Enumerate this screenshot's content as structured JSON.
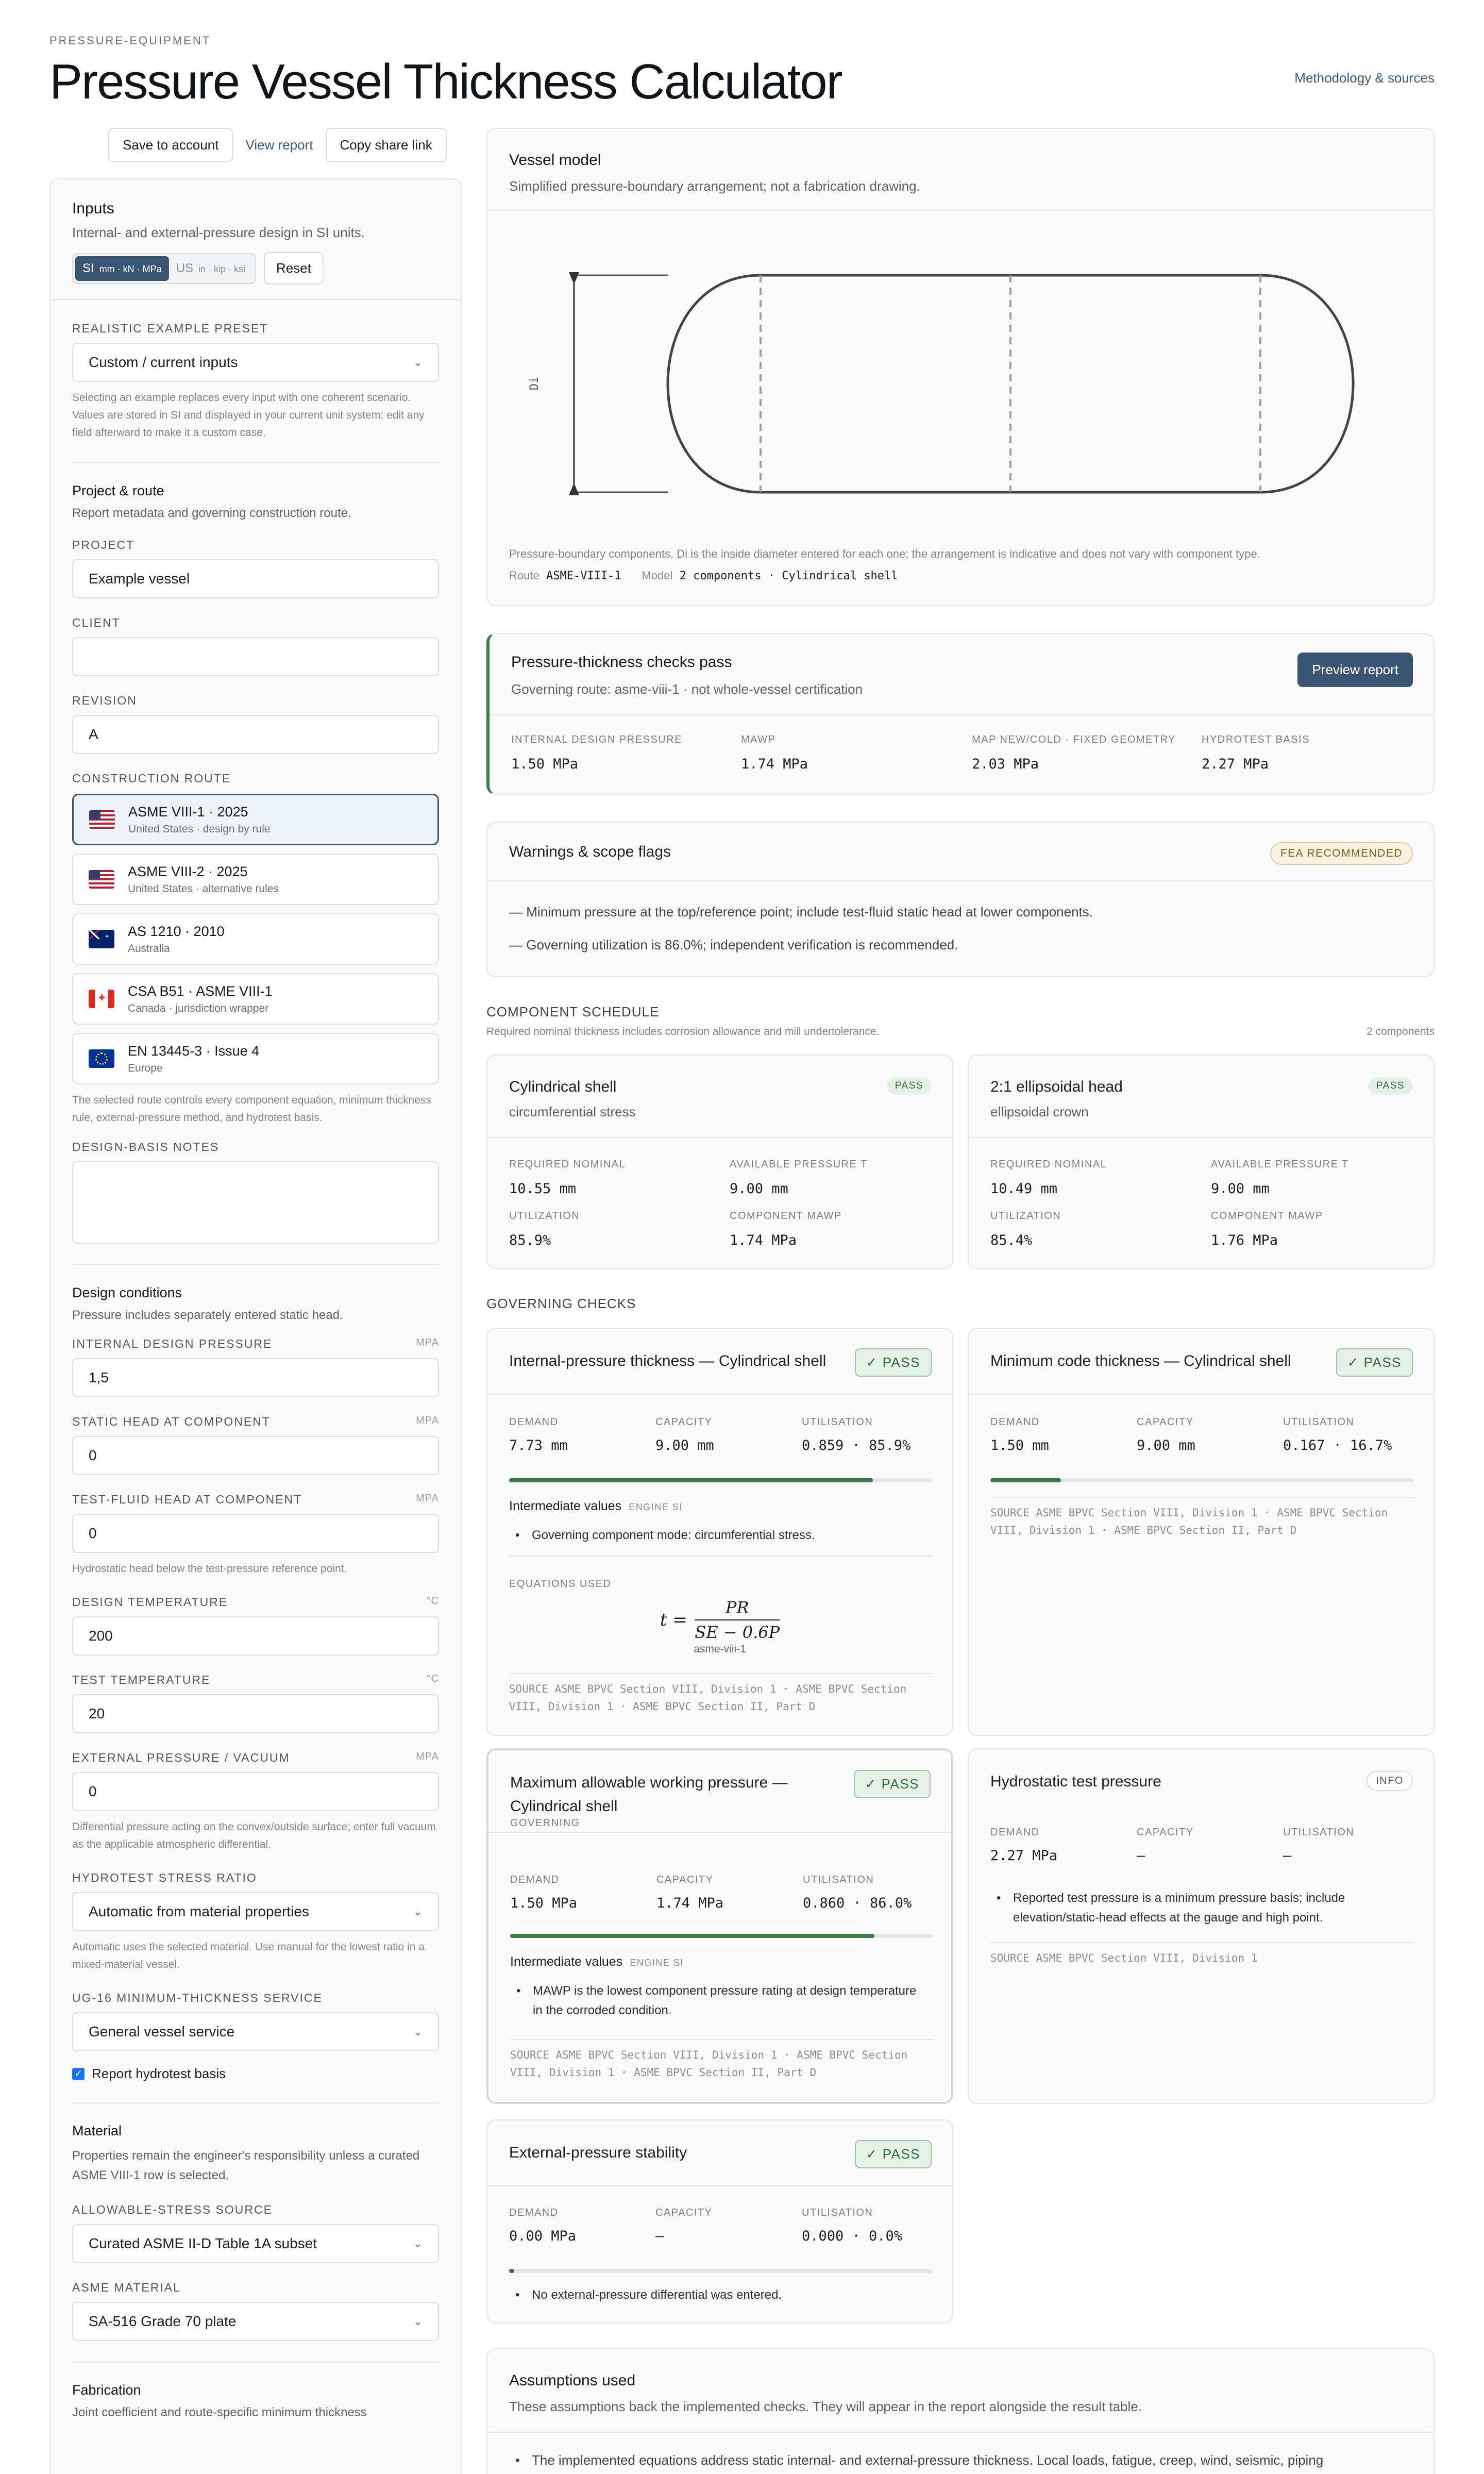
{
  "header": {
    "eyebrow": "PRESSURE-EQUIPMENT",
    "title": "Pressure Vessel Thickness Calculator",
    "methodology_link": "Methodology & sources"
  },
  "actions": {
    "save": "Save to account",
    "view": "View report",
    "copy": "Copy share link"
  },
  "inputs": {
    "title": "Inputs",
    "subtitle": "Internal- and external-pressure design in SI units.",
    "units": {
      "si_label": "SI",
      "si_detail": "mm · kN · MPa",
      "us_label": "US",
      "us_detail": "in · kip · ksi",
      "reset": "Reset"
    },
    "preset": {
      "label": "REALISTIC EXAMPLE PRESET",
      "value": "Custom / current inputs",
      "help": "Selecting an example replaces every input with one coherent scenario. Values are stored in SI and displayed in your current unit system; edit any field afterward to make it a custom case."
    },
    "project_route": {
      "title": "Project & route",
      "subtitle": "Report metadata and governing construction route.",
      "project_label": "PROJECT",
      "project_value": "Example vessel",
      "client_label": "CLIENT",
      "client_value": "",
      "revision_label": "REVISION",
      "revision_value": "A",
      "route_label": "CONSTRUCTION ROUTE",
      "routes": [
        {
          "name": "ASME VIII-1 · 2025",
          "sub": "United States · design by rule",
          "flag": "us"
        },
        {
          "name": "ASME VIII-2 · 2025",
          "sub": "United States · alternative rules",
          "flag": "us"
        },
        {
          "name": "AS 1210 · 2010",
          "sub": "Australia",
          "flag": "au"
        },
        {
          "name": "CSA B51 · ASME VIII-1",
          "sub": "Canada · jurisdiction wrapper",
          "flag": "ca"
        },
        {
          "name": "EN 13445-3 · Issue 4",
          "sub": "Europe",
          "flag": "eu"
        }
      ],
      "route_help": "The selected route controls every component equation, minimum thickness rule, external-pressure method, and hydrotest basis.",
      "notes_label": "DESIGN-BASIS NOTES",
      "notes_value": ""
    },
    "design_conditions": {
      "title": "Design conditions",
      "subtitle": "Pressure includes separately entered static head.",
      "pressure_label": "INTERNAL DESIGN PRESSURE",
      "pressure_unit": "MPa",
      "pressure_value": "1,5",
      "static_label": "STATIC HEAD AT COMPONENT",
      "static_unit": "MPa",
      "static_value": "0",
      "testfluid_label": "TEST-FLUID HEAD AT COMPONENT",
      "testfluid_unit": "MPa",
      "testfluid_value": "0",
      "testfluid_help": "Hydrostatic head below the test-pressure reference point.",
      "temp_label": "DESIGN TEMPERATURE",
      "temp_unit": "°C",
      "temp_value": "200",
      "testtemp_label": "TEST TEMPERATURE",
      "testtemp_unit": "°C",
      "testtemp_value": "20",
      "ext_label": "EXTERNAL PRESSURE / VACUUM",
      "ext_unit": "MPa",
      "ext_value": "0",
      "ext_help": "Differential pressure acting on the convex/outside surface; enter full vacuum as the applicable atmospheric differential.",
      "ratio_label": "HYDROTEST STRESS RATIO",
      "ratio_value": "Automatic from material properties",
      "ratio_help": "Automatic uses the selected material. Use manual for the lowest ratio in a mixed-material vessel.",
      "ug16_label": "UG-16 MINIMUM-THICKNESS SERVICE",
      "ug16_value": "General vessel service",
      "hydro_check_label": "Report hydrotest basis"
    },
    "material": {
      "title": "Material",
      "subtitle": "Properties remain the engineer's responsibility unless a curated ASME VIII-1 row is selected.",
      "source_label": "ALLOWABLE-STRESS SOURCE",
      "source_value": "Curated ASME II-D Table 1A subset",
      "asme_label": "ASME MATERIAL",
      "asme_value": "SA-516 Grade 70 plate"
    },
    "fabrication": {
      "title": "Fabrication",
      "subtitle": "Joint coefficient and route-specific minimum thickness"
    }
  },
  "vessel_model": {
    "title": "Vessel model",
    "subtitle": "Simplified pressure-boundary arrangement; not a fabrication drawing.",
    "di_label": "Di",
    "caption": "Pressure-boundary components. Di is the inside diameter entered for each one; the arrangement is indicative and does not vary with component type.",
    "route_label": "Route",
    "route_value": "ASME-VIII-1",
    "model_label": "Model",
    "model_value": "2 components · Cylindrical shell"
  },
  "status": {
    "title": "Pressure-thickness checks pass",
    "subtitle": "Governing route: asme-viii-1 · not whole-vessel certification",
    "preview": "Preview report",
    "metrics": [
      {
        "label": "INTERNAL DESIGN PRESSURE",
        "value": "1.50 MPa"
      },
      {
        "label": "MAWP",
        "value": "1.74 MPa"
      },
      {
        "label": "MAP NEW/COLD · FIXED GEOMETRY",
        "value": "2.03 MPa"
      },
      {
        "label": "HYDROTEST BASIS",
        "value": "2.27 MPa"
      }
    ]
  },
  "warnings": {
    "title": "Warnings & scope flags",
    "badge": "FEA RECOMMENDED",
    "items": [
      "— Minimum pressure at the top/reference point; include test-fluid static head at lower components.",
      "— Governing utilization is 86.0%; independent verification is recommended."
    ]
  },
  "schedule": {
    "label": "COMPONENT SCHEDULE",
    "subtitle": "Required nominal thickness includes corrosion allowance and mill undertolerance.",
    "count": "2 components",
    "components": [
      {
        "name": "Cylindrical shell",
        "mode": "circumferential stress",
        "status": "PASS",
        "req_label": "REQUIRED NOMINAL",
        "req": "10.55 mm",
        "avail_label": "AVAILABLE PRESSURE T",
        "avail": "9.00 mm",
        "util_label": "UTILIZATION",
        "util": "85.9%",
        "mawp_label": "COMPONENT MAWP",
        "mawp": "1.74 MPa"
      },
      {
        "name": "2:1 ellipsoidal head",
        "mode": "ellipsoidal crown",
        "status": "PASS",
        "req_label": "REQUIRED NOMINAL",
        "req": "10.49 mm",
        "avail_label": "AVAILABLE PRESSURE T",
        "avail": "9.00 mm",
        "util_label": "UTILIZATION",
        "util": "85.4%",
        "mawp_label": "COMPONENT MAWP",
        "mawp": "1.76 MPa"
      }
    ]
  },
  "governing": {
    "label": "GOVERNING CHECKS",
    "col_demand": "DEMAND",
    "col_capacity": "CAPACITY",
    "col_util": "UTILISATION",
    "pass": "PASS",
    "info": "INFO",
    "intermediate": "Intermediate values",
    "engine": "ENGINE SI",
    "equations_label": "EQUATIONS USED",
    "source_label": "SOURCE",
    "checks": [
      {
        "title": "Internal-pressure thickness — Cylindrical shell",
        "demand": "7.73 mm",
        "capacity": "9.00 mm",
        "util": "0.859 · 85.9%",
        "fill": 0.859,
        "bullet": "Governing component mode: circumferential stress.",
        "eq_caption": "asme-viii-1",
        "source": "ASME BPVC Section VIII, Division 1 · ASME BPVC Section VIII, Division 1 · ASME BPVC Section II, Part D"
      },
      {
        "title": "Minimum code thickness — Cylindrical shell",
        "demand": "1.50 mm",
        "capacity": "9.00 mm",
        "util": "0.167 · 16.7%",
        "fill": 0.167,
        "source": "ASME BPVC Section VIII, Division 1 · ASME BPVC Section VIII, Division 1 · ASME BPVC Section II, Part D"
      },
      {
        "title": "Maximum allowable working pressure — Cylindrical shell",
        "tag": "GOVERNING",
        "demand": "1.50 MPa",
        "capacity": "1.74 MPa",
        "util": "0.860 · 86.0%",
        "fill": 0.86,
        "bullet": "MAWP is the lowest component pressure rating at design temperature in the corroded condition.",
        "source": "ASME BPVC Section VIII, Division 1 · ASME BPVC Section VIII, Division 1 · ASME BPVC Section II, Part D"
      },
      {
        "title": "Hydrostatic test pressure",
        "demand": "2.27 MPa",
        "capacity": "—",
        "util": "—",
        "bullet": "Reported test pressure is a minimum pressure basis; include elevation/static-head effects at the gauge and high point.",
        "source": "ASME BPVC Section VIII, Division 1"
      },
      {
        "title": "External-pressure stability",
        "demand": "0.00 MPa",
        "capacity": "—",
        "util": "0.000 · 0.0%",
        "fill": 0.0,
        "bullet": "No external-pressure differential was entered."
      }
    ]
  },
  "assumptions": {
    "title": "Assumptions used",
    "subtitle": "These assumptions back the implemented checks. They will appear in the report alongside the result table.",
    "first_item": "The implemented equations address static internal- and external-pressure thickness. Local loads, fatigue, creep, wind, seismic, piping"
  },
  "colors": {
    "accent": "#3b5574",
    "pass_green": "#3b7a4a",
    "warning_amber": "#8a5a12"
  }
}
